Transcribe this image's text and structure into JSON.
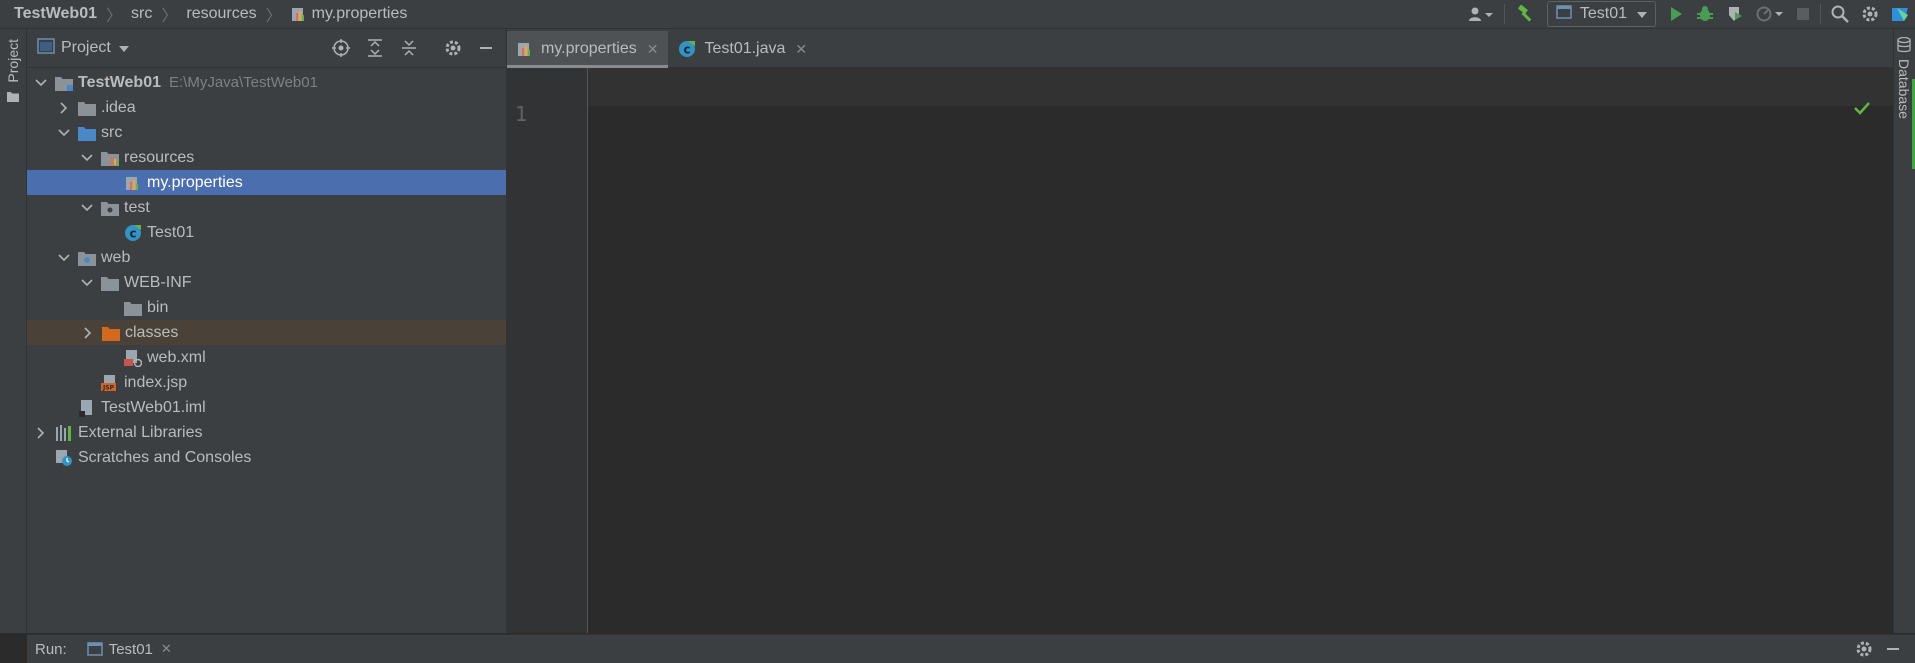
{
  "breadcrumb": {
    "project": "TestWeb01",
    "items": [
      "src",
      "resources",
      "my.properties"
    ]
  },
  "toolbar": {
    "run_config": "Test01"
  },
  "project_panel": {
    "title": "Project",
    "side_tab": "Project"
  },
  "tree": {
    "root": {
      "label": "TestWeb01",
      "path": "E:\\MyJava\\TestWeb01"
    },
    "idea": ".idea",
    "src": "src",
    "resources": "resources",
    "my_properties": "my.properties",
    "test": "test",
    "test01": "Test01",
    "web": "web",
    "web_inf": "WEB-INF",
    "bin": "bin",
    "classes": "classes",
    "web_xml": "web.xml",
    "index_jsp": "index.jsp",
    "iml": "TestWeb01.iml",
    "external": "External Libraries",
    "scratches": "Scratches and Consoles"
  },
  "editor": {
    "tabs": [
      {
        "label": "my.properties",
        "active": true
      },
      {
        "label": "Test01.java",
        "active": false
      }
    ],
    "line_number": "1"
  },
  "right_strip": {
    "label": "Database"
  },
  "bottom": {
    "run_label": "Run:",
    "run_tab": "Test01"
  },
  "colors": {
    "background": "#2b2b2b",
    "panel": "#3c3f41",
    "selection": "#4b6eaf",
    "excluded": "#4a4238",
    "run_green": "#499c54",
    "folder_blue": "#4a88c7",
    "folder_orange": "#d2691e"
  }
}
